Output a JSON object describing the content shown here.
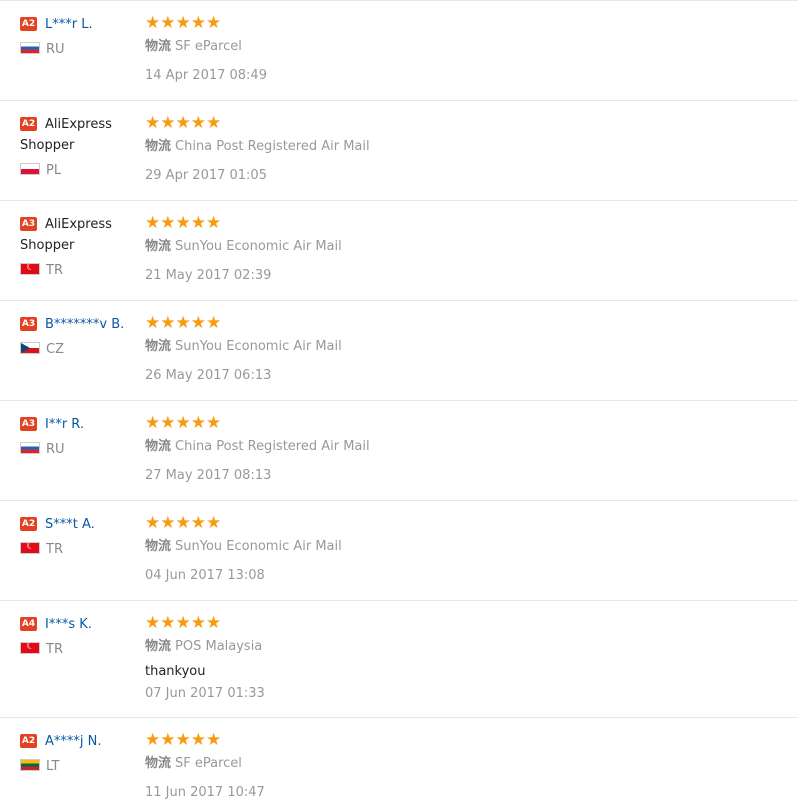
{
  "logistics_label": "物流",
  "stars": "★★★★★",
  "reviews": [
    {
      "level": "A2",
      "name": "L***r L.",
      "country": "RU",
      "flag": "ru",
      "carrier": "SF eParcel",
      "feedback": "",
      "date": "14 Apr 2017 08:49"
    },
    {
      "level": "A2",
      "name": "AliExpress Shopper",
      "country": "PL",
      "flag": "pl",
      "carrier": "China Post Registered Air Mail",
      "feedback": "",
      "date": "29 Apr 2017 01:05"
    },
    {
      "level": "A3",
      "name": "AliExpress Shopper",
      "country": "TR",
      "flag": "tr",
      "carrier": "SunYou Economic Air Mail",
      "feedback": "",
      "date": "21 May 2017 02:39"
    },
    {
      "level": "A3",
      "name": "B*******v B.",
      "country": "CZ",
      "flag": "cz",
      "carrier": "SunYou Economic Air Mail",
      "feedback": "",
      "date": "26 May 2017 06:13"
    },
    {
      "level": "A3",
      "name": "I**r R.",
      "country": "RU",
      "flag": "ru",
      "carrier": "China Post Registered Air Mail",
      "feedback": "",
      "date": "27 May 2017 08:13"
    },
    {
      "level": "A2",
      "name": "S***t A.",
      "country": "TR",
      "flag": "tr",
      "carrier": "SunYou Economic Air Mail",
      "feedback": "",
      "date": "04 Jun 2017 13:08"
    },
    {
      "level": "A4",
      "name": "I***s K.",
      "country": "TR",
      "flag": "tr",
      "carrier": "POS Malaysia",
      "feedback": "thankyou",
      "date": "07 Jun 2017 01:33"
    },
    {
      "level": "A2",
      "name": "A****j N.",
      "country": "LT",
      "flag": "lt",
      "carrier": "SF eParcel",
      "feedback": "",
      "date": "11 Jun 2017 10:47"
    }
  ]
}
